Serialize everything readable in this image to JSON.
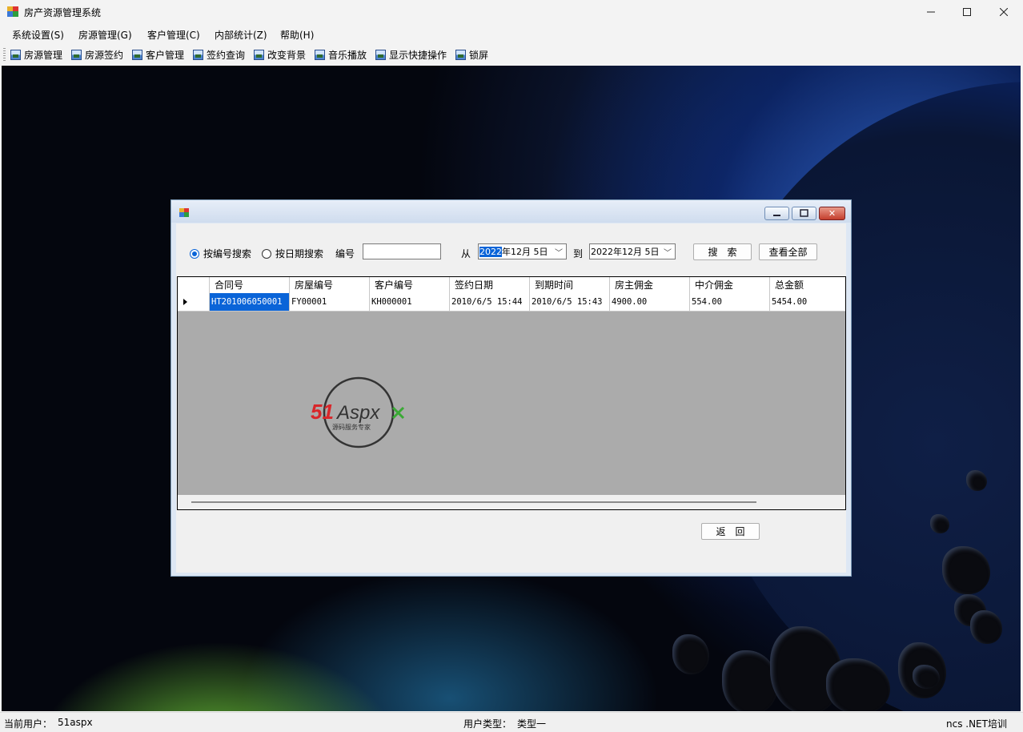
{
  "window": {
    "title": "房产资源管理系统"
  },
  "menu": [
    "系统设置(S)",
    "房源管理(G)",
    "客户管理(C)",
    "内部统计(Z)",
    "帮助(H)"
  ],
  "toolbar": [
    "房源管理",
    "房源签约",
    "客户管理",
    "签约查询",
    "改变背景",
    "音乐播放",
    "显示快捷操作",
    "锁屏"
  ],
  "dialog": {
    "radio_by_number": "按编号搜索",
    "radio_by_date": "按日期搜索",
    "number_label": "编号",
    "number_value": "",
    "from_label": "从",
    "from_date_year": "2022",
    "from_date_rest": "年12月 5日",
    "to_label": "到",
    "to_date": "2022年12月 5日",
    "search_button": "搜　索",
    "view_all_button": "查看全部",
    "back_button": "返　回",
    "selected_radio": "by_number"
  },
  "grid": {
    "columns": [
      "合同号",
      "房屋编号",
      "客户编号",
      "签约日期",
      "到期时间",
      "房主佣金",
      "中介佣金",
      "总金额"
    ],
    "rows": [
      [
        "HT201006050001",
        "FY00001",
        "KH000001",
        "2010/6/5 15:44",
        "2010/6/5 15:43",
        "4900.00",
        "554.00",
        "5454.00"
      ]
    ]
  },
  "watermark": {
    "brand": "51Aspx",
    "tagline": "源码服务专家"
  },
  "status": {
    "user_label": "当前用户：",
    "user_value": "51aspx",
    "type_label": "用户类型：",
    "type_value": "类型一",
    "right_text": "ncs .NET培训"
  },
  "colors": {
    "selection": "#0a64d8",
    "accent_red": "#d9262a",
    "accent_green": "#3aa935"
  }
}
